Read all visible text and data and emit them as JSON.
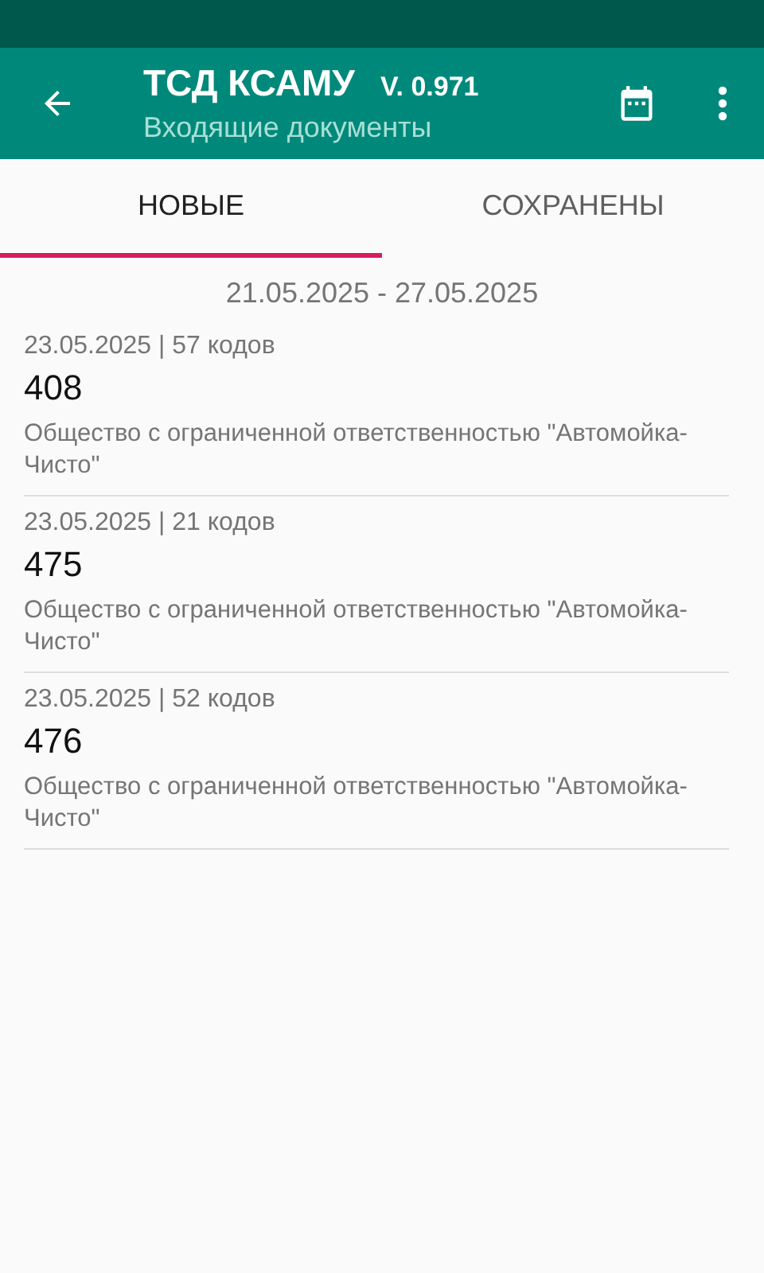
{
  "app_bar": {
    "title": "ТСД КСАМУ",
    "version": "V. 0.971",
    "subtitle": "Входящие документы"
  },
  "tabs": [
    {
      "label": "НОВЫЕ",
      "selected": true
    },
    {
      "label": "СОХРАНЕНЫ",
      "selected": false
    }
  ],
  "date_range": "21.05.2025 - 27.05.2025",
  "documents": [
    {
      "meta": "23.05.2025 | 57 кодов",
      "number": "408",
      "company": "Общество с ограниченной ответственностью \"Автомойка-Чисто\""
    },
    {
      "meta": "23.05.2025 | 21 кодов",
      "number": "475",
      "company": "Общество с ограниченной ответственностью \"Автомойка-Чисто\""
    },
    {
      "meta": "23.05.2025 | 52 кодов",
      "number": "476",
      "company": "Общество с ограниченной ответственностью \"Автомойка-Чисто\""
    }
  ]
}
